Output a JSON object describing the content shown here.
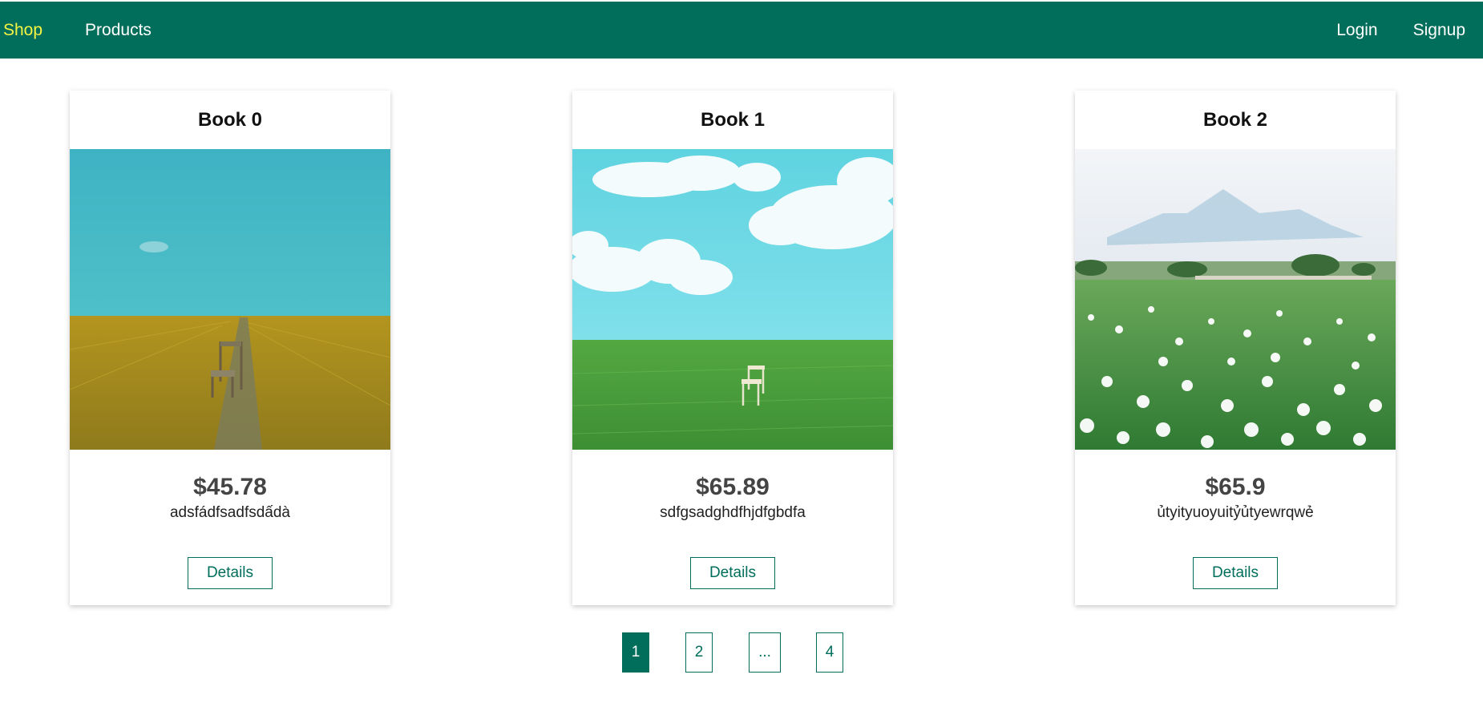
{
  "nav": {
    "brand": "Shop",
    "products": "Products",
    "login": "Login",
    "signup": "Signup"
  },
  "colors": {
    "primary": "#006e5a",
    "brand_text": "#f5f542"
  },
  "cards": [
    {
      "title": "Book 0",
      "price": "$45.78",
      "description": "adsfádfsadfsdấdà",
      "button": "Details",
      "image": "yellow-field-chair"
    },
    {
      "title": "Book 1",
      "price": "$65.89",
      "description": "sdfgsadghdfhjdfgbdfa",
      "button": "Details",
      "image": "green-field-chair-clouds"
    },
    {
      "title": "Book 2",
      "price": "$65.9",
      "description": "ủtyityuoyuitỷủtyewrqwẻ",
      "button": "Details",
      "image": "dandelion-meadow-mountains"
    }
  ],
  "pagination": {
    "pages": [
      "1",
      "2",
      "...",
      "4"
    ],
    "current": "1"
  }
}
